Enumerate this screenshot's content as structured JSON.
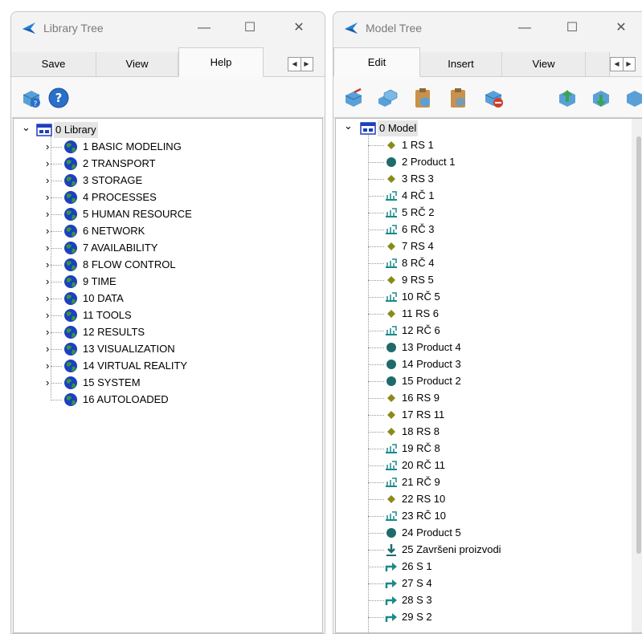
{
  "library_window": {
    "title": "Library Tree",
    "window_controls": {
      "minimize": "—",
      "maximize": "☐",
      "close": "✕"
    },
    "tabs": [
      "Save",
      "View",
      "Help"
    ],
    "active_tab": "Help",
    "tab_nav": {
      "left": "◀",
      "right": "▶"
    },
    "toolbar": [
      "library-help-icon",
      "help-question-icon"
    ],
    "tree": {
      "root": "0 Library",
      "items": [
        "1 BASIC MODELING",
        "2 TRANSPORT",
        "3 STORAGE",
        "4 PROCESSES",
        "5 HUMAN RESOURCE",
        "6 NETWORK",
        "7 AVAILABILITY",
        "8 FLOW CONTROL",
        "9 TIME",
        "10 DATA",
        "11 TOOLS",
        "12 RESULTS",
        "13 VISUALIZATION",
        "14 VIRTUAL REALITY",
        "15 SYSTEM",
        "16 AUTOLOADED"
      ],
      "expand_glyph": "›",
      "collapse_glyph": "⌄"
    }
  },
  "model_window": {
    "title": "Model Tree",
    "window_controls": {
      "minimize": "—",
      "maximize": "☐",
      "close": "✕"
    },
    "tabs": [
      "Edit",
      "Insert",
      "View"
    ],
    "active_tab": "Edit",
    "tab_nav": {
      "left": "◀",
      "right": "▶"
    },
    "toolbar": [
      "cut-icon",
      "copy-icon",
      "paste-icon",
      "paste-special-icon",
      "delete-icon",
      "move-up-icon",
      "move-down-icon",
      "move-icon"
    ],
    "tree": {
      "root": "0 Model",
      "items": [
        {
          "label": "1 RS 1",
          "icon": "diamond"
        },
        {
          "label": "2 Product 1",
          "icon": "circle"
        },
        {
          "label": "3 RS 3",
          "icon": "diamond"
        },
        {
          "label": "4 RČ 1",
          "icon": "rc"
        },
        {
          "label": "5 RČ 2",
          "icon": "rc"
        },
        {
          "label": "6 RČ 3",
          "icon": "rc"
        },
        {
          "label": "7 RS 4",
          "icon": "diamond"
        },
        {
          "label": "8 RČ 4",
          "icon": "rc"
        },
        {
          "label": "9 RS 5",
          "icon": "diamond"
        },
        {
          "label": "10 RČ 5",
          "icon": "rc"
        },
        {
          "label": "11 RS 6",
          "icon": "diamond"
        },
        {
          "label": "12 RČ 6",
          "icon": "rc"
        },
        {
          "label": "13 Product 4",
          "icon": "circle"
        },
        {
          "label": "14 Product 3",
          "icon": "circle"
        },
        {
          "label": "15 Product 2",
          "icon": "circle"
        },
        {
          "label": "16 RS 9",
          "icon": "diamond"
        },
        {
          "label": "17 RS 11",
          "icon": "diamond"
        },
        {
          "label": "18 RS 8",
          "icon": "diamond"
        },
        {
          "label": "19 RČ 8",
          "icon": "rc"
        },
        {
          "label": "20 RČ 11",
          "icon": "rc"
        },
        {
          "label": "21 RČ 9",
          "icon": "rc"
        },
        {
          "label": "22 RS 10",
          "icon": "diamond"
        },
        {
          "label": "23 RČ 10",
          "icon": "rc"
        },
        {
          "label": "24 Product 5",
          "icon": "circle"
        },
        {
          "label": "25 Završeni proizvodi",
          "icon": "sink"
        },
        {
          "label": "26 S 1",
          "icon": "arrow"
        },
        {
          "label": "27 S 4",
          "icon": "arrow"
        },
        {
          "label": "28 S 3",
          "icon": "arrow"
        },
        {
          "label": "29 S 2",
          "icon": "arrow"
        }
      ]
    }
  },
  "colors": {
    "diamond": "#8a8a1a",
    "circle": "#1f6b6b",
    "teal": "#1a8a8a",
    "globe_blue": "#1e3fbf",
    "globe_green": "#2f9a3c",
    "app_blue": "#2a7fd4"
  }
}
